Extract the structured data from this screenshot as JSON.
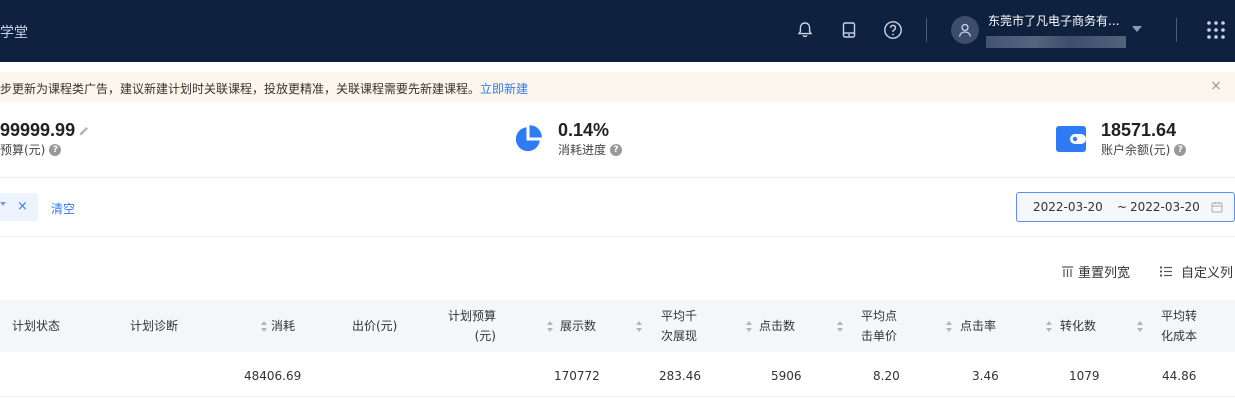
{
  "header": {
    "brand_text": "学堂",
    "account_name": "东莞市了凡电子商务有...",
    "icons": [
      "bell-icon",
      "tablet-icon",
      "help-circle-icon",
      "user-avatar-icon",
      "apps-grid-icon"
    ]
  },
  "notice": {
    "text": "步更新为课程类广告，建议新建计划时关联课程，投放更精准，关联课程需要先新建课程。",
    "link": "立即新建",
    "close": "×"
  },
  "stats": {
    "budget": {
      "value": "99999.99",
      "label": "预算(元)"
    },
    "progress": {
      "value": "0.14%",
      "label": "消耗进度",
      "fraction": 0.0014
    },
    "balance": {
      "value": "18571.64",
      "label": "账户余额(元)"
    }
  },
  "filter": {
    "tag_close": "×",
    "clear": "清空",
    "date_from": "2022-03-20",
    "date_sep": "~",
    "date_to": "2022-03-20"
  },
  "toolbar": {
    "reset_columns": "重置列宽",
    "custom_columns": "自定义列"
  },
  "table": {
    "headers": {
      "status": "计划状态",
      "diagnosis": "计划诊断",
      "cost": "消耗",
      "bid": "出价(元)",
      "budget_1": "计划预算",
      "budget_2": "(元)",
      "impressions": "展示数",
      "cpm_1": "平均千",
      "cpm_2": "次展现",
      "clicks": "点击数",
      "cpc_1": "平均点",
      "cpc_2": "击单价",
      "ctr": "点击率",
      "conversions": "转化数",
      "cpa_1": "平均转",
      "cpa_2": "化成本"
    },
    "row": {
      "cost": "48406.69",
      "impressions": "170772",
      "cpm": "283.46",
      "clicks": "5906",
      "cpc": "8.20",
      "ctr": "3.46",
      "conversions": "1079",
      "cpa": "44.86"
    }
  },
  "colors": {
    "topbar": "#0e2240",
    "accent": "#2f7bf5",
    "notice_bg": "#fdf6ec",
    "table_header_bg": "#f5f6f8"
  }
}
